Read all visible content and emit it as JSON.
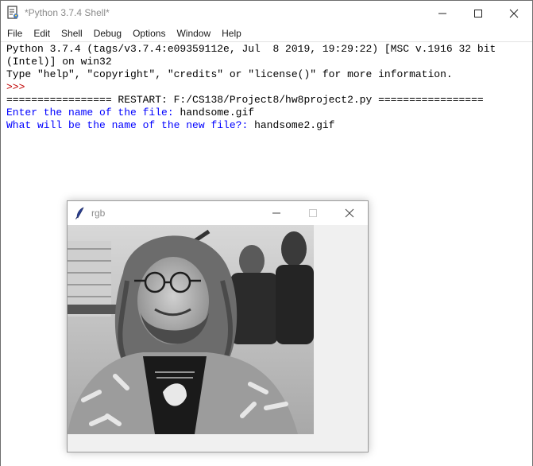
{
  "shell": {
    "title": "*Python 3.7.4 Shell*",
    "app_icon": "idle-shell-icon",
    "menu": [
      "File",
      "Edit",
      "Shell",
      "Debug",
      "Options",
      "Window",
      "Help"
    ],
    "lines": [
      "Python 3.7.4 (tags/v3.7.4:e09359112e, Jul  8 2019, 19:29:22) [MSC v.1916 32 bit",
      "(Intel)] on win32",
      "Type \"help\", \"copyright\", \"credits\" or \"license()\" for more information.",
      ">>> ",
      "================= RESTART: F:/CS138/Project8/hw8project2.py =================",
      "Enter the name of the file: ",
      "handsome.gif",
      "What will be the name of the new file?: ",
      "handsome2.gif"
    ]
  },
  "rgb_window": {
    "title": "rgb",
    "icon": "tk-feather-icon",
    "image": "grayscale-photo"
  },
  "colors": {
    "prompt": "#c00000",
    "stdout_prompt": "#0000ff",
    "user_input": "#000000",
    "title_text": "#8a8a8a"
  }
}
